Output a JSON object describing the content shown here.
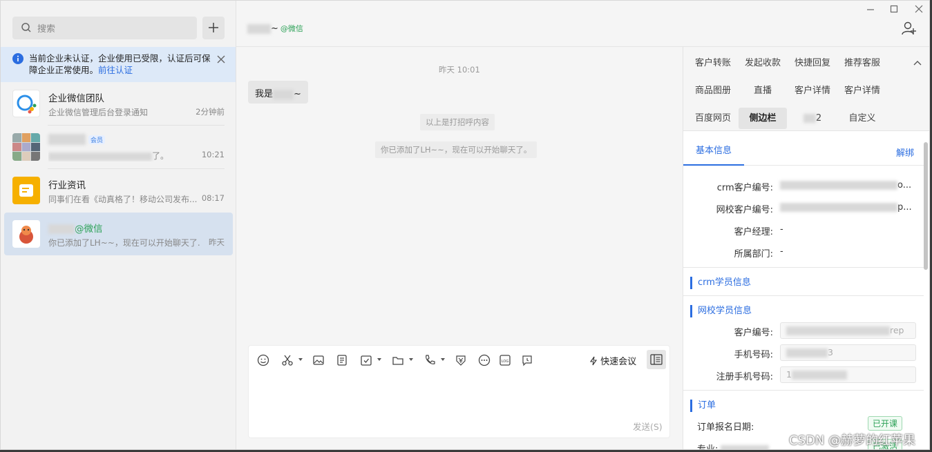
{
  "search": {
    "placeholder": "搜索"
  },
  "notice": {
    "text": "当前企业未认证，企业使用已受限，认证后可保障企业正常使用。",
    "link": "前往认证"
  },
  "conversations": [
    {
      "name": "企业微信团队",
      "preview": "企业微信管理后台登录通知",
      "time": "2分钟前"
    },
    {
      "name": "",
      "badge": "会员",
      "preview": "了。",
      "time": "10:21"
    },
    {
      "name": "行业资讯",
      "preview": "同事们在看《动真格了！移动公司发布...",
      "time": "08:17"
    },
    {
      "name_suffix": "@微信",
      "preview": "你已添加了LH~~，现在可以开始聊天了...",
      "time": "昨天"
    }
  ],
  "header": {
    "title_suffix": "~",
    "source": "@微信"
  },
  "chat": {
    "time": "昨天 10:01",
    "bubble_prefix": "我是",
    "bubble_suffix": "~",
    "sys1": "以上是打招呼内容",
    "sys2": "你已添加了LH~~，现在可以开始聊天了。"
  },
  "input": {
    "quick_meeting": "快速会议",
    "send": "发送(S)"
  },
  "right_tabs": [
    "客户转账",
    "发起收款",
    "快捷回复",
    "推荐客服",
    "商品图册",
    "直播",
    "客户详情",
    "客户详情",
    "百度网页",
    "侧边栏",
    "2",
    "自定义"
  ],
  "sub_tabs": {
    "basic": "基本信息",
    "unbind": "解绑"
  },
  "basic_info": [
    {
      "label": "crm客户编号:",
      "value": "o..."
    },
    {
      "label": "网校客户编号:",
      "value": "p..."
    },
    {
      "label": "客户经理:",
      "value": "-"
    },
    {
      "label": "所属部门:",
      "value": "-"
    }
  ],
  "sections": {
    "crm": "crm学员信息",
    "school": "网校学员信息",
    "order": "订单"
  },
  "school_fields": [
    {
      "label": "客户编号:",
      "value": "rep"
    },
    {
      "label": "手机号码:",
      "value": "3"
    },
    {
      "label": "注册手机号码:",
      "value": "1"
    }
  ],
  "order": {
    "date_label": "订单报名日期:",
    "status1": "已开课",
    "major_label": "专业:",
    "status2": "已激活"
  },
  "watermark": "CSDN @赫萝的红苹果"
}
